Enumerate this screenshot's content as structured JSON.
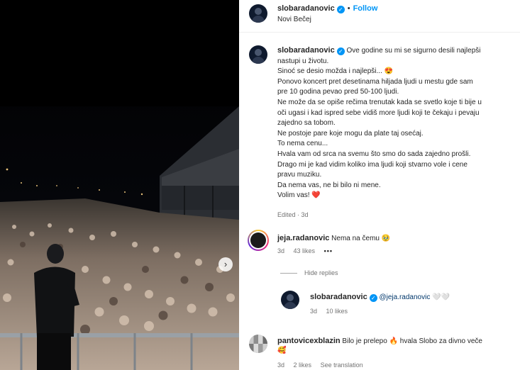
{
  "post": {
    "username": "slobaradanovic",
    "follow_label": "Follow",
    "separator": "•",
    "location": "Novi Bečej"
  },
  "caption": {
    "username": "slobaradanovic",
    "lines": [
      "Ove godine su mi se sigurno desili najlepši",
      "nastupi u životu.",
      "Sinoć se desio možda i najlepši... 😍",
      "Ponovo koncert pret desetinama hiljada ljudi u mestu gde sam",
      "pre 10 godina pevao pred 50-100 ljudi.",
      "Ne može da se opiše rečima trenutak kada se svetlo koje ti bije u",
      "oči ugasi i kad ispred sebe vidiš more ljudi koji te čekaju i pevaju",
      "zajedno sa tobom.",
      "Ne postoje pare koje mogu da plate taj osećaj.",
      "To nema cenu...",
      "Hvala vam od srca na svemu što smo do sada zajedno prošli.",
      "Drago mi je kad vidim koliko ima ljudi koji stvarno vole i cene",
      "pravu muziku.",
      "Da nema vas, ne bi bilo ni mene.",
      "Volim vas! ❤️"
    ],
    "edited": "Edited · 3d"
  },
  "comments": [
    {
      "username": "jeja.radanovic",
      "text": "Nema na čemu 🥹",
      "time": "3d",
      "likes": "43 likes",
      "more": "•••"
    },
    {
      "username": "slobaradanovic",
      "mention": "@jeja.radanovic",
      "text": "🤍🤍",
      "time": "3d",
      "likes": "10 likes"
    },
    {
      "username": "pantovicexblazin",
      "text": "Bilo je prelepo 🔥 hvala Slobo za divno veče",
      "text2": "🥰",
      "time": "3d",
      "likes": "2 likes",
      "see_translation": "See translation"
    }
  ],
  "hide_replies": "Hide replies",
  "media": {
    "next_icon": "chevron-right-icon",
    "next_glyph": "›"
  },
  "colors": {
    "accent": "#0095f6",
    "verified": "#0095f6",
    "heart": "#ed4956"
  }
}
